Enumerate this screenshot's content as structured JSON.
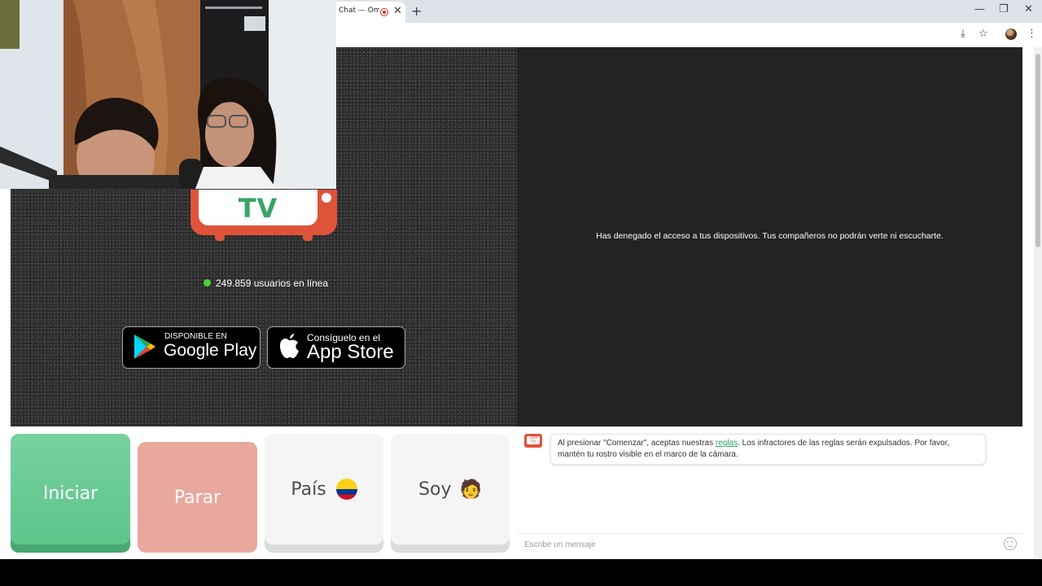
{
  "browser": {
    "tab_title": "Chat — Ome",
    "close_glyph": "✕",
    "new_tab_glyph": "+",
    "window": {
      "minimize": "—",
      "restore": "❐",
      "close": "✕"
    },
    "toolbar": {
      "install_icon": "⤓",
      "star_icon": "☆",
      "menu_icon": "⋮"
    }
  },
  "logo": {
    "text": "TV"
  },
  "status": {
    "online_count_text": "249.859 usuarios en línea"
  },
  "stores": {
    "google_play": {
      "small": "DISPONIBLE EN",
      "big": "Google Play"
    },
    "app_store": {
      "small": "Consíguelo en el",
      "big": "App Store"
    }
  },
  "remote": {
    "message": "Has denegado el acceso a tus dispositivos. Tus compañeros no podrán verte ni escucharte."
  },
  "controls": {
    "start_label": "Iniciar",
    "stop_label": "Parar",
    "country_label": "País",
    "gender_label": "Soy",
    "gender_emoji": "🧑"
  },
  "chat": {
    "logo_text": "Ome TV",
    "notice_before": "Al presionar \"Comenzar\", aceptas nuestras ",
    "notice_link": "reglas",
    "notice_after": ". Los infractores de las reglas serán expulsados. Por favor, mantén tu rostro visible en el marco de la cámara.",
    "input_placeholder": "Escribe un mensaje"
  },
  "colors": {
    "start_green": "#5bc489",
    "stop_salmon": "#e9a89d",
    "brand_red": "#e0533b",
    "brand_green": "#3aa468",
    "online_dot": "#4cd137"
  }
}
